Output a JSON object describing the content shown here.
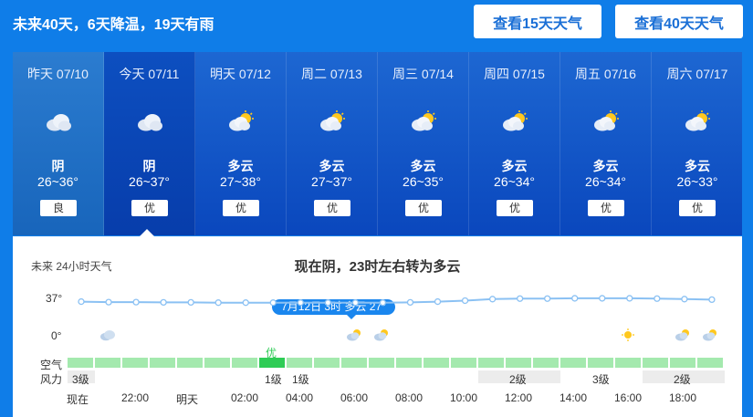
{
  "header": {
    "summary": "未来40天，6天降温，19天有雨",
    "btn15": "查看15天天气",
    "btn40": "查看40天天气"
  },
  "days": [
    {
      "label": "昨天 07/10",
      "weather": "阴",
      "temp": "26~36°",
      "air": "良",
      "icon": "overcast-cloud-icon"
    },
    {
      "label": "今天 07/11",
      "weather": "阴",
      "temp": "26~37°",
      "air": "优",
      "icon": "overcast-cloud-icon"
    },
    {
      "label": "明天 07/12",
      "weather": "多云",
      "temp": "27~38°",
      "air": "优",
      "icon": "partly-cloudy-icon"
    },
    {
      "label": "周二 07/13",
      "weather": "多云",
      "temp": "27~37°",
      "air": "优",
      "icon": "partly-cloudy-icon"
    },
    {
      "label": "周三 07/14",
      "weather": "多云",
      "temp": "26~35°",
      "air": "优",
      "icon": "partly-cloudy-icon"
    },
    {
      "label": "周四 07/15",
      "weather": "多云",
      "temp": "26~34°",
      "air": "优",
      "icon": "partly-cloudy-icon"
    },
    {
      "label": "周五 07/16",
      "weather": "多云",
      "temp": "26~34°",
      "air": "优",
      "icon": "partly-cloudy-icon"
    },
    {
      "label": "周六 07/17",
      "weather": "多云",
      "temp": "26~33°",
      "air": "优",
      "icon": "partly-cloudy-icon"
    }
  ],
  "hourly": {
    "title": "未来 24小时天气",
    "now_text": "现在阴，23时左右转为多云",
    "y_max": "37°",
    "y_min": "0°",
    "tooltip": "7月12日 3时 多云 27°",
    "air_label": "空气",
    "air_current": "优",
    "wind_label": "风力",
    "wind_levels": [
      "3级",
      "1级",
      "1级",
      "2级",
      "3级",
      "2级"
    ],
    "ticks": [
      "现在",
      "22:00",
      "明天",
      "02:00",
      "04:00",
      "06:00",
      "08:00",
      "10:00",
      "12:00",
      "14:00",
      "16:00",
      "18:00"
    ],
    "colors": {
      "line": "#8bc1f3",
      "air": "#a4e9ae",
      "air_current": "#2ecc55",
      "tooltip": "#1a86ee"
    }
  },
  "chart_data": {
    "type": "line",
    "x": [
      "现在",
      "21:00",
      "22:00",
      "23:00",
      "明天",
      "01:00",
      "02:00",
      "03:00",
      "04:00",
      "05:00",
      "06:00",
      "07:00",
      "08:00",
      "09:00",
      "10:00",
      "11:00",
      "12:00",
      "13:00",
      "14:00",
      "15:00",
      "16:00",
      "17:00",
      "18:00",
      "19:00"
    ],
    "series": [
      {
        "values": [
          27,
          26.5,
          26.5,
          26.3,
          26.3,
          26,
          26,
          26,
          26,
          26,
          26,
          26,
          26.3,
          27,
          28,
          29.5,
          30,
          30,
          30.3,
          30.3,
          30.3,
          30,
          29.5,
          29
        ]
      }
    ],
    "ylim": [
      0,
      37
    ],
    "grid": false
  }
}
